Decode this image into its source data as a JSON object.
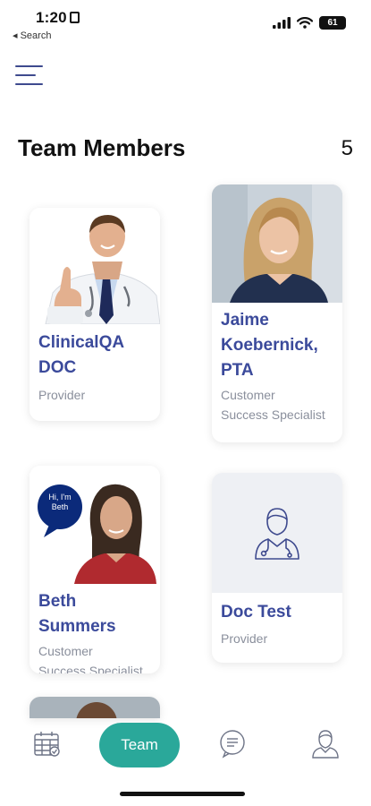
{
  "status_bar": {
    "time": "1:20",
    "back_label": "◂ Search",
    "battery": "61"
  },
  "header": {
    "title": "Team Members",
    "count": "5"
  },
  "members": [
    {
      "name_lines": [
        "ClinicalQA",
        "DOC"
      ],
      "role_lines": [
        "Provider"
      ]
    },
    {
      "name_lines": [
        "Jaime",
        "Koebernick,",
        "PTA"
      ],
      "role_lines": [
        "Customer",
        "Success Specialist"
      ]
    },
    {
      "name_lines": [
        "Beth",
        "Summers"
      ],
      "role_lines": [
        "Customer",
        "Success Specialist"
      ],
      "bubble_text": [
        "Hi, I'm",
        "Beth"
      ]
    },
    {
      "name_lines": [
        "Doc Test"
      ],
      "role_lines": [
        "Provider"
      ]
    }
  ],
  "bottom_nav": {
    "team_label": "Team",
    "items": [
      "calendar-icon",
      "team",
      "chat-icon",
      "profile-icon"
    ]
  },
  "colors": {
    "accent": "#2aa89a",
    "name_blue": "#3b4a9b",
    "role_gray": "#8a8f9c"
  }
}
